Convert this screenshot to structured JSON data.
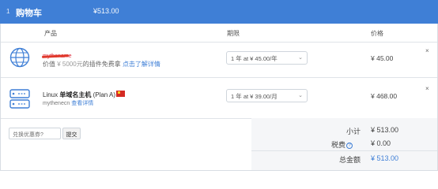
{
  "header": {
    "step": "1",
    "title": "购物车",
    "total": "¥513.00"
  },
  "columns": {
    "product": "产品",
    "period": "期限",
    "price": "价格"
  },
  "items": [
    {
      "icon": "globe-icon",
      "name": "mythename",
      "desc_prefix": "价值 ",
      "desc_strike": "¥ 5000元",
      "desc_mid": "的插件免费拿 ",
      "desc_link": "点击了解详情",
      "period": "1 年 at ¥ 45.00/年",
      "price": "¥ 45.00",
      "remove": "×"
    },
    {
      "icon": "server-icon",
      "name_prefix": "Linux ",
      "name_bold": "单域名主机",
      "name_suffix": " (Plan A)",
      "sub": "mythenecn",
      "sub_link": "查看详情",
      "period": "1 年 at ¥ 39.00/月",
      "price": "¥ 468.00",
      "remove": "×"
    }
  ],
  "coupon": {
    "placeholder": "兑换优惠券?",
    "button": "提交"
  },
  "summary": {
    "subtotal_label": "小计",
    "subtotal": "¥ 513.00",
    "tax_label": "税费",
    "tax_help": "?",
    "tax": "¥ 0.00",
    "total_label": "总金额",
    "total": "¥ 513.00"
  },
  "colors": {
    "accent": "#3f7fd6",
    "flag": "#d42a24"
  }
}
